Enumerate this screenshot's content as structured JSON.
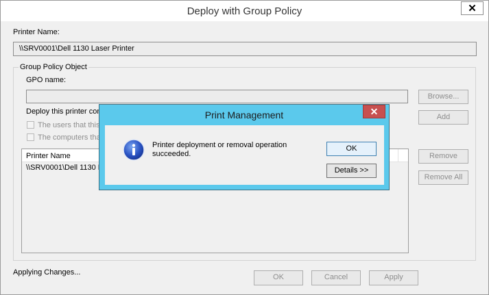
{
  "window": {
    "title": "Deploy with Group Policy",
    "close_glyph": "✕"
  },
  "printer_name": {
    "label": "Printer Name:",
    "value": "\\\\SRV0001\\Dell 1130 Laser Printer"
  },
  "gpo_group": {
    "title": "Group Policy Object",
    "gpo_name_label": "GPO name:",
    "gpo_name_value": "",
    "browse_label": "Browse...",
    "deploy_label": "Deploy this printer con",
    "checkbox_users": "The users that this",
    "checkbox_computers": "The computers tha",
    "add_label": "Add"
  },
  "list": {
    "column_header": "Printer Name",
    "rows": [
      "\\\\SRV0001\\Dell 1130 L"
    ],
    "remove_label": "Remove",
    "remove_all_label": "Remove All"
  },
  "footer": {
    "status": "Applying Changes...",
    "ok_label": "OK",
    "cancel_label": "Cancel",
    "apply_label": "Apply"
  },
  "dialog": {
    "title": "Print Management",
    "close_glyph": "✕",
    "message_line1": "Printer deployment or removal operation",
    "message_line2": "succeeded.",
    "ok_label": "OK",
    "details_label": "Details >>",
    "icon": "info-icon"
  },
  "colors": {
    "dialog_frame": "#5bc9ec",
    "dialog_close": "#c75050",
    "focus_border": "#3c7fb1",
    "info_icon_blue": "#1a3fa8"
  }
}
